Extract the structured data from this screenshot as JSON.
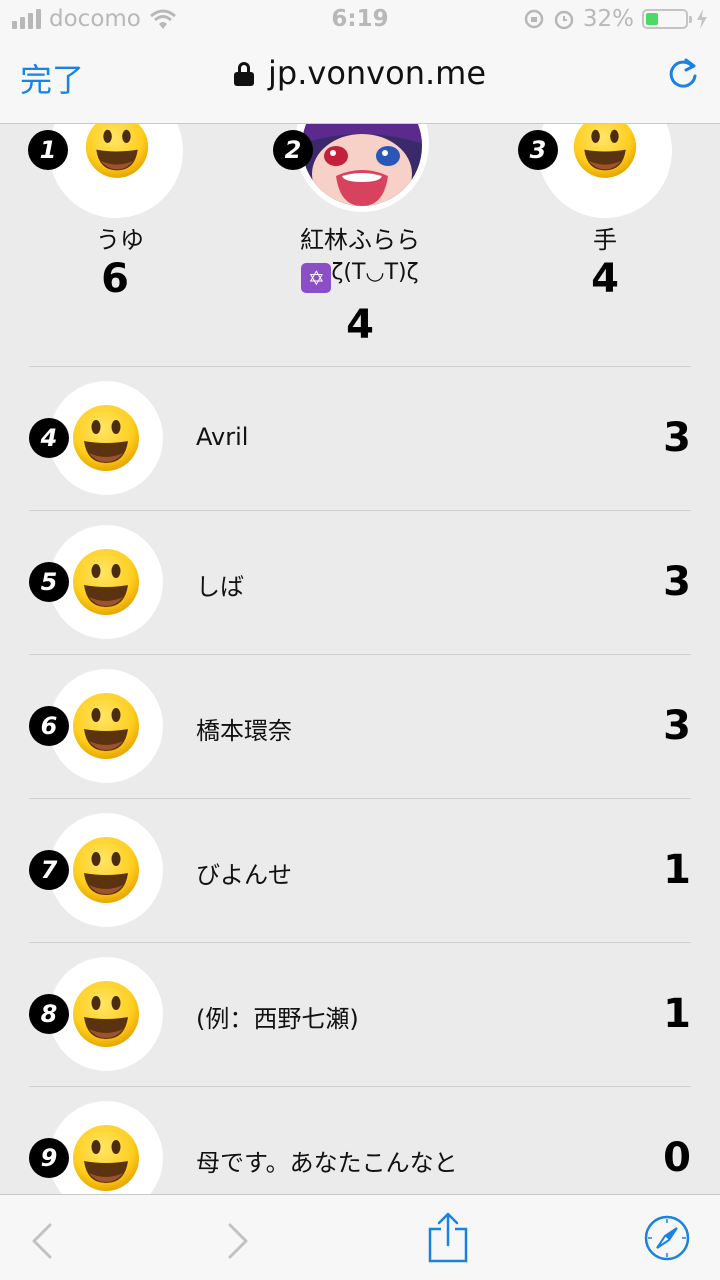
{
  "status_bar": {
    "carrier": "docomo",
    "time": "6:19",
    "battery": "32%",
    "battery_level": 0.32
  },
  "nav": {
    "done_label": "完了",
    "url": "jp.vonvon.me"
  },
  "podium": [
    {
      "rank": "1",
      "name": "うゆ",
      "name_line2": "",
      "score": "6"
    },
    {
      "rank": "2",
      "name": "紅林ふらら",
      "name_line2": "ζ(T◡T)ζ",
      "score": "4"
    },
    {
      "rank": "3",
      "name": "手",
      "name_line2": "",
      "score": "4"
    }
  ],
  "rows": [
    {
      "rank": "4",
      "name": "Avril",
      "score": "3"
    },
    {
      "rank": "5",
      "name": "しば",
      "score": "3"
    },
    {
      "rank": "6",
      "name": "橋本環奈",
      "score": "3"
    },
    {
      "rank": "7",
      "name": "びよんせ",
      "score": "1"
    },
    {
      "rank": "8",
      "name": "(例：西野七瀬)",
      "score": "1"
    },
    {
      "rank": "9",
      "name": "母です。あなたこんなと",
      "score": "0"
    }
  ],
  "icons": {
    "status": [
      "signal-icon",
      "wifi-icon",
      "rotation-lock-icon",
      "alarm-icon",
      "battery-icon",
      "charging-icon"
    ],
    "nav": [
      "lock-icon",
      "reload-icon"
    ],
    "toolbar": [
      "back-icon",
      "forward-icon",
      "share-icon",
      "safari-compass-icon"
    ]
  },
  "colors": {
    "accent": "#1a82e2",
    "battery": "#4cd964",
    "badge": "#000000"
  }
}
